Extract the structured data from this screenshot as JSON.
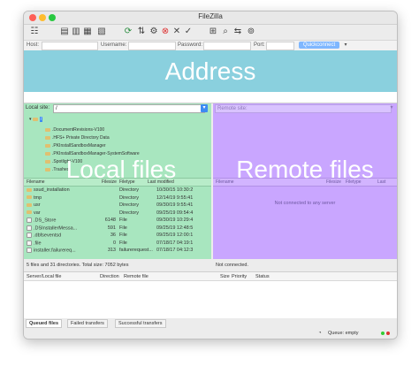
{
  "window": {
    "title": "FileZilla"
  },
  "quickconnect": {
    "host_label": "Host:",
    "username_label": "Username:",
    "password_label": "Password:",
    "port_label": "Port:",
    "button_label": "Quickconnect"
  },
  "overlays": {
    "address": "Address",
    "local": "Local files",
    "remote": "Remote files"
  },
  "local": {
    "site_label": "Local site:",
    "path": "/",
    "tree": [
      ".DocumentRevisions-V100",
      ".HFS+ Private Directory Data",
      ".PKInstallSandboxManager",
      ".PKInstallSandboxManager-SystemSoftware",
      ".Spotlight-V100",
      ".Trashes"
    ],
    "columns": {
      "filename": "Filename",
      "filesize": "Filesize",
      "filetype": "Filetype",
      "modified": "Last modified"
    },
    "rows": [
      {
        "name": "ssud_installation",
        "size": "",
        "type": "Directory",
        "modified": "10/30/15 10:30:2"
      },
      {
        "name": "tmp",
        "size": "",
        "type": "Directory",
        "modified": "12/14/19 9:55:41"
      },
      {
        "name": "usr",
        "size": "",
        "type": "Directory",
        "modified": "09/30/19 9:55:41"
      },
      {
        "name": "var",
        "size": "",
        "type": "Directory",
        "modified": "09/25/19 09:54:4"
      },
      {
        "name": ".DS_Store",
        "size": "6148",
        "type": "File",
        "modified": "09/30/19 10:29:4"
      },
      {
        "name": ".DSInstallerMessa...",
        "size": "591",
        "type": "File",
        "modified": "09/25/19 12:48:5"
      },
      {
        "name": ".dbfseventsd",
        "size": "36",
        "type": "File",
        "modified": "09/25/19 12:00:1"
      },
      {
        "name": ".file",
        "size": "0",
        "type": "File",
        "modified": "07/18/17 04:19:1"
      },
      {
        "name": "installer.failurereq...",
        "size": "313",
        "type": "failurerequest...",
        "modified": "07/18/17 04:12:3"
      }
    ],
    "status": "5 files and 31 directories. Total size: 7052 bytes"
  },
  "remote": {
    "site_label": "Remote site:",
    "columns": {
      "filename": "Filename",
      "filesize": "Filesize",
      "filetype": "Filetype",
      "modified": "Last"
    },
    "empty_text": "Not connected to any server",
    "status": "Not connected."
  },
  "queue": {
    "columns": [
      "Server/Local file",
      "Direction",
      "Remote file",
      "Size",
      "Priority",
      "Status"
    ],
    "tabs": [
      "Queued files",
      "Failed transfers",
      "Successful transfers"
    ],
    "status_text": "Queue: empty"
  },
  "colors": {
    "address_overlay": "#8ad0de",
    "local_overlay": "#a8e6bf",
    "remote_overlay": "#c9a6ff"
  }
}
